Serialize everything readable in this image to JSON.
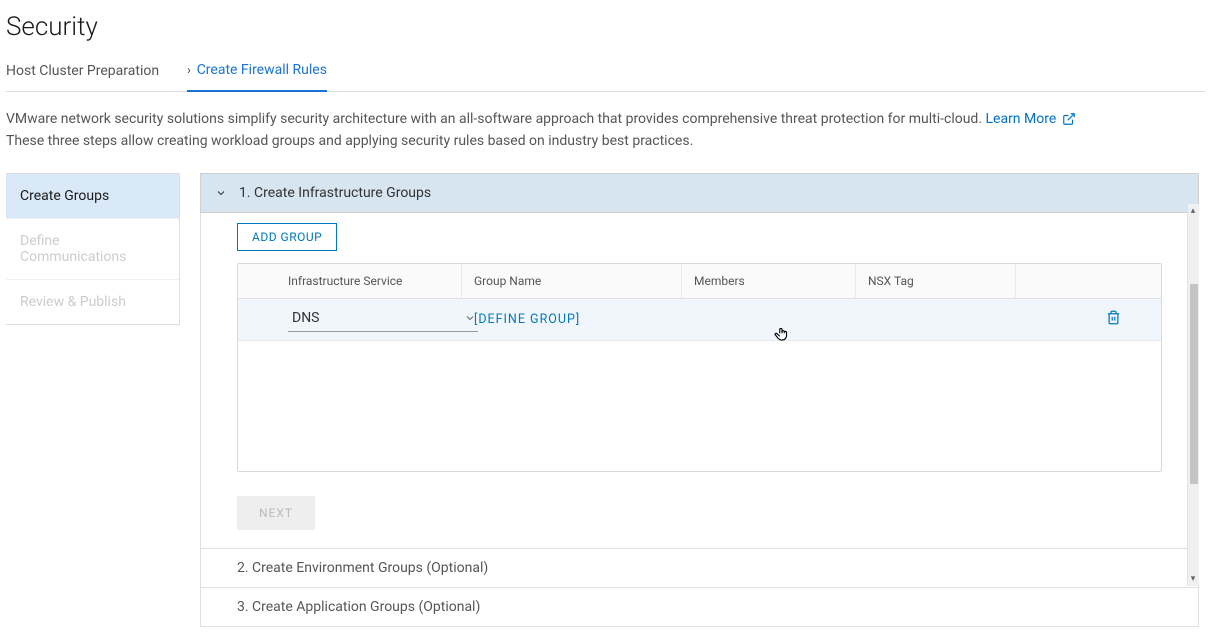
{
  "page": {
    "title": "Security",
    "description_line1_a": "VMware network security solutions simplify security architecture with an all-software approach that provides comprehensive threat protection for multi-cloud. ",
    "learn_more_label": "Learn More",
    "description_line2": "These three steps allow creating workload groups and applying security rules based on industry best practices."
  },
  "tabs": [
    {
      "label": "Host Cluster Preparation"
    },
    {
      "label": "Create Firewall Rules"
    }
  ],
  "sidebar": {
    "items": [
      {
        "label": "Create Groups"
      },
      {
        "label": "Define Communications"
      },
      {
        "label": "Review & Publish"
      }
    ]
  },
  "accordions": [
    {
      "label": "1. Create Infrastructure Groups"
    },
    {
      "label": "2. Create Environment Groups (Optional)"
    },
    {
      "label": "3. Create Application Groups (Optional)"
    }
  ],
  "buttons": {
    "add_group": "ADD GROUP",
    "next": "NEXT"
  },
  "table": {
    "headers": {
      "service": "Infrastructure Service",
      "group_name": "Group Name",
      "members": "Members",
      "nsx_tag": "NSX Tag"
    },
    "rows": [
      {
        "service": "DNS",
        "group_action": "[DEFINE GROUP]",
        "members": "",
        "nsx_tag": ""
      }
    ]
  }
}
